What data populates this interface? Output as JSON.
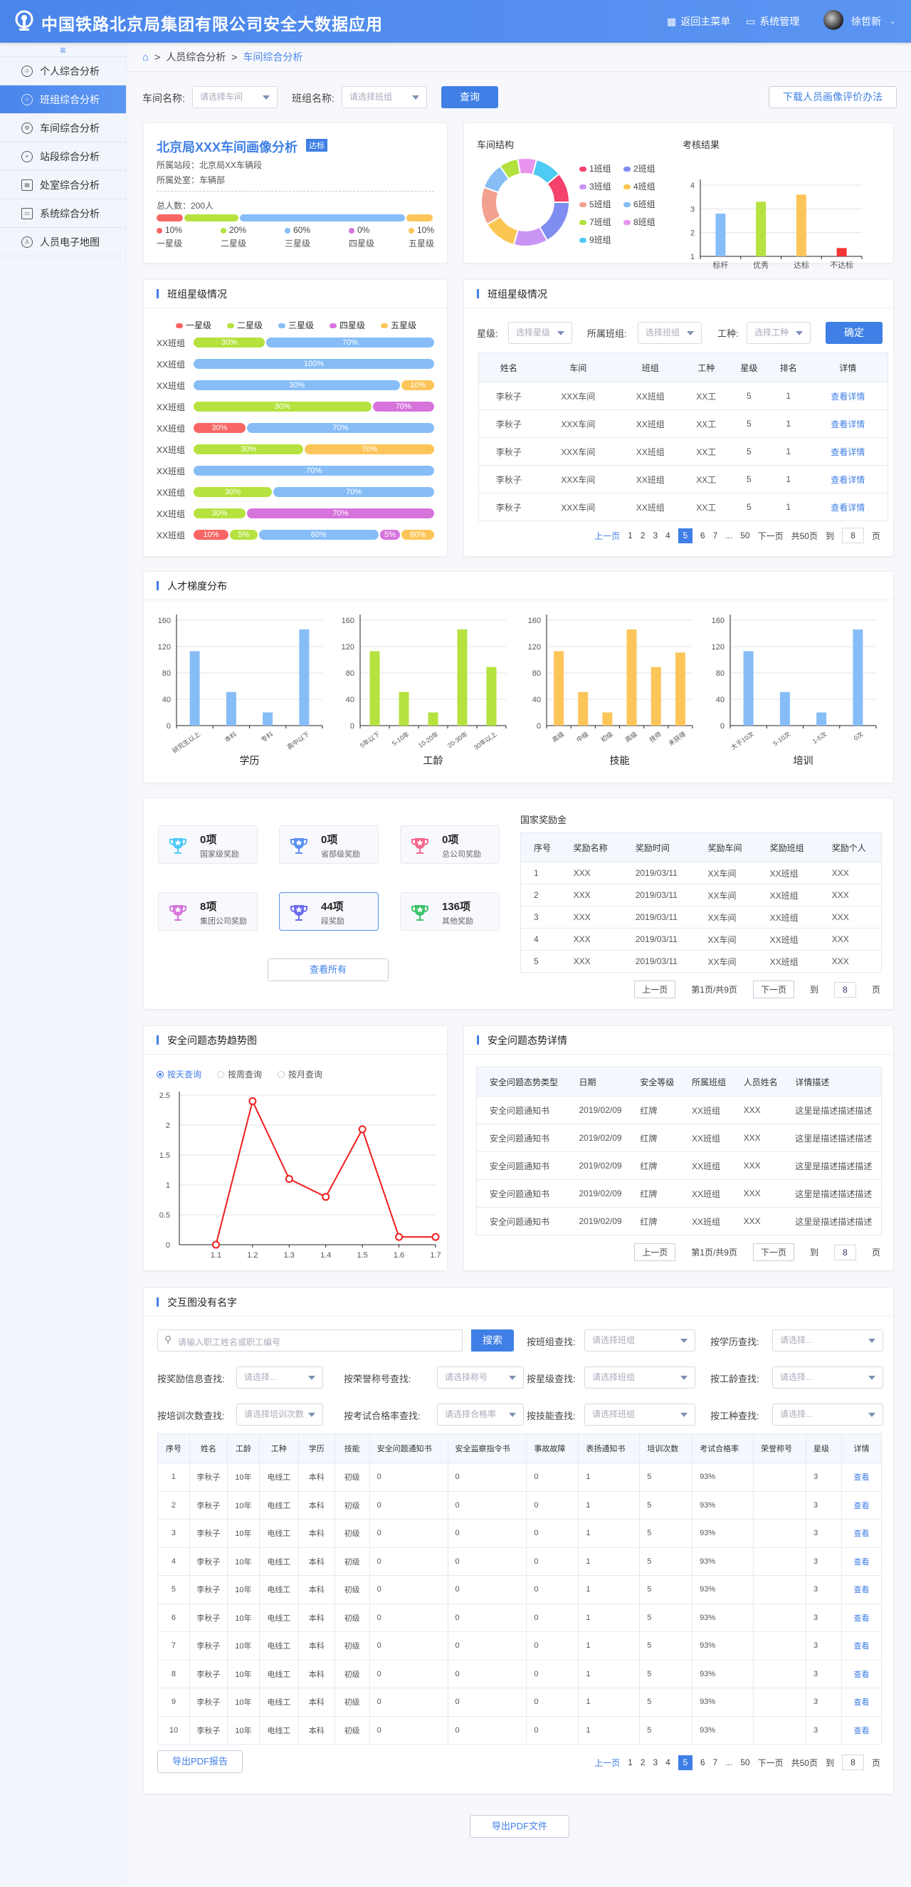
{
  "header": {
    "title": "中国铁路北京局集团有限公司安全大数据应用",
    "back_menu": "返回主菜单",
    "system_mgmt": "系统管理",
    "user": "徐哲新"
  },
  "sidebar": {
    "items": [
      {
        "label": "个人综合分析"
      },
      {
        "label": "班组综合分析"
      },
      {
        "label": "车间综合分析"
      },
      {
        "label": "站段综合分析"
      },
      {
        "label": "处室综合分析"
      },
      {
        "label": "系统综合分析"
      },
      {
        "label": "人员电子地图"
      }
    ]
  },
  "breadcrumb": [
    "人员综合分析",
    "车间综合分析"
  ],
  "filters": {
    "workshop_label": "车间名称:",
    "workshop_ph": "请选择车间",
    "team_label": "班组名称:",
    "team_ph": "请选择班组",
    "query": "查询",
    "download": "下载人员画像评价办法"
  },
  "profile": {
    "title": "北京局XXX车间画像分析",
    "badge": "达标",
    "station": "所属站段：北京局XX车辆段",
    "office": "所属处室：车辆部",
    "total": "总人数：200人",
    "levels": [
      {
        "pct": "10%",
        "name": "一星级",
        "v": 10,
        "color": "#f76565"
      },
      {
        "pct": "20%",
        "name": "二星级",
        "v": 20,
        "color": "#b5e23f"
      },
      {
        "pct": "60%",
        "name": "三星级",
        "v": 60,
        "color": "#86bdf7"
      },
      {
        "pct": "0%",
        "name": "四星级",
        "v": 0,
        "color": "#d674dc"
      },
      {
        "pct": "10%",
        "name": "五星级",
        "v": 10,
        "color": "#fcc55a"
      }
    ]
  },
  "structure": {
    "title": "车间结构",
    "legend": [
      "1班组",
      "2班组",
      "3班组",
      "4班组",
      "5班组",
      "6班组",
      "7班组",
      "8班组",
      "9班组"
    ],
    "values": [
      40,
      60,
      45,
      45,
      50,
      35,
      25,
      25,
      35
    ],
    "colors": [
      "#f5426c",
      "#7f8cf0",
      "#c995f5",
      "#fcc652",
      "#f2a08f",
      "#86bdf5",
      "#b3e13e",
      "#e894ee",
      "#4ecbf5"
    ]
  },
  "chart_data": [
    {
      "type": "bar",
      "title": "考核结果",
      "categories": [
        "标杆",
        "优秀",
        "达标",
        "不达标"
      ],
      "values": [
        2.8,
        3.3,
        3.6,
        1.35
      ],
      "colors": [
        "#86bdf7",
        "#b5e23f",
        "#fcc55a",
        "#f43434"
      ],
      "ylim": [
        1,
        4
      ],
      "yticks": [
        "1",
        "2",
        "3",
        "4"
      ]
    },
    {
      "type": "bar",
      "title": "学历",
      "categories": [
        "研究生以上",
        "本科",
        "专科",
        "高中以下"
      ],
      "values": [
        113,
        51,
        20,
        146
      ],
      "color": "#86bdf7",
      "ylim": [
        0,
        160
      ],
      "yticks": [
        "0",
        "40",
        "80",
        "120",
        "160"
      ]
    },
    {
      "type": "bar",
      "title": "工龄",
      "categories": [
        "5年以下",
        "5-10年",
        "10-20年",
        "20-30年",
        "30年以上"
      ],
      "values": [
        113,
        51,
        20,
        146,
        89
      ],
      "color": "#b5e23f",
      "ylim": [
        0,
        160
      ],
      "yticks": [
        "0",
        "40",
        "80",
        "120",
        "160"
      ]
    },
    {
      "type": "bar",
      "title": "技能",
      "categories": [
        "高级",
        "中级",
        "初级",
        "高级",
        "技师",
        "未获得"
      ],
      "values": [
        113,
        51,
        20,
        146,
        89,
        111
      ],
      "color": "#fcc55a",
      "ylim": [
        0,
        160
      ],
      "yticks": [
        "0",
        "40",
        "80",
        "120",
        "160"
      ]
    },
    {
      "type": "bar",
      "title": "培训",
      "categories": [
        "大于10次",
        "5-10次",
        "1-5次",
        "0次"
      ],
      "values": [
        113,
        51,
        20,
        146
      ],
      "color": "#86bdf7",
      "ylim": [
        0,
        160
      ],
      "yticks": [
        "0",
        "40",
        "80",
        "120",
        "160"
      ]
    },
    {
      "type": "line",
      "title": "安全问题态势趋势图",
      "x": [
        "1.1",
        "1.2",
        "1.3",
        "1.4",
        "1.5",
        "1.6",
        "1.7"
      ],
      "values": [
        0,
        2.4,
        1.1,
        0.8,
        1.93,
        0.13,
        0.13
      ],
      "color": "#f21d1d",
      "ylim": [
        0,
        2.5
      ],
      "yticks": [
        "0",
        "0.5",
        "1",
        "1.5",
        "2",
        "2.5"
      ]
    }
  ],
  "team_star": {
    "title": "班组星级情况",
    "legend": [
      "一星级",
      "二星级",
      "三星级",
      "四星级",
      "五星级"
    ],
    "rows": [
      {
        "label": "XX班组",
        "segs": [
          {
            "l": 1,
            "v": 30,
            "t": "30%"
          },
          {
            "l": 2,
            "v": 70,
            "t": "70%"
          }
        ]
      },
      {
        "label": "XX班组",
        "segs": [
          {
            "l": 2,
            "v": 100,
            "t": "100%"
          }
        ]
      },
      {
        "label": "XX班组",
        "segs": [
          {
            "l": 2,
            "v": 86,
            "t": "30%"
          },
          {
            "l": 4,
            "v": 14,
            "t": "10%"
          }
        ]
      },
      {
        "label": "XX班组",
        "segs": [
          {
            "l": 1,
            "v": 74,
            "t": "30%"
          },
          {
            "l": 3,
            "v": 26,
            "t": "70%"
          }
        ]
      },
      {
        "label": "XX班组",
        "segs": [
          {
            "l": 0,
            "v": 22,
            "t": "30%"
          },
          {
            "l": 2,
            "v": 78,
            "t": "70%"
          }
        ]
      },
      {
        "label": "XX班组",
        "segs": [
          {
            "l": 1,
            "v": 46,
            "t": "30%"
          },
          {
            "l": 4,
            "v": 54,
            "t": "70%"
          }
        ]
      },
      {
        "label": "XX班组",
        "segs": [
          {
            "l": 2,
            "v": 100,
            "t": "70%"
          }
        ]
      },
      {
        "label": "XX班组",
        "segs": [
          {
            "l": 1,
            "v": 33,
            "t": "30%"
          },
          {
            "l": 2,
            "v": 67,
            "t": "70%"
          }
        ]
      },
      {
        "label": "XX班组",
        "segs": [
          {
            "l": 1,
            "v": 22,
            "t": "30%"
          },
          {
            "l": 3,
            "v": 78,
            "t": "70%"
          }
        ]
      },
      {
        "label": "XX班组",
        "segs": [
          {
            "l": 0,
            "v": 15,
            "t": "10%"
          },
          {
            "l": 1,
            "v": 12,
            "t": "5%"
          },
          {
            "l": 2,
            "v": 50,
            "t": "60%"
          },
          {
            "l": 3,
            "v": 9,
            "t": "5%"
          },
          {
            "l": 4,
            "v": 14,
            "t": "60%"
          }
        ]
      }
    ]
  },
  "team_table": {
    "title": "班组星级情况",
    "star_label": "星级:",
    "star_ph": "选择星级",
    "team_label": "所属班组:",
    "team_ph": "选择班组",
    "type_label": "工种:",
    "type_ph": "选择工种",
    "confirm": "确定",
    "columns": [
      "姓名",
      "车间",
      "班组",
      "工种",
      "星级",
      "排名",
      "详情"
    ],
    "rows": [
      [
        "李秋子",
        "XXX车间",
        "XX班组",
        "XX工",
        "5",
        "1",
        "查看详情"
      ],
      [
        "李秋子",
        "XXX车间",
        "XX班组",
        "XX工",
        "5",
        "1",
        "查看详情"
      ],
      [
        "李秋子",
        "XXX车间",
        "XX班组",
        "XX工",
        "5",
        "1",
        "查看详情"
      ],
      [
        "李秋子",
        "XXX车间",
        "XX班组",
        "XX工",
        "5",
        "1",
        "查看详情"
      ],
      [
        "李秋子",
        "XXX车间",
        "XX班组",
        "XX工",
        "5",
        "1",
        "查看详情"
      ]
    ]
  },
  "pager": {
    "prev": "上一页",
    "pages": [
      "1",
      "2",
      "3",
      "4",
      "5",
      "6",
      "7",
      "...",
      "50"
    ],
    "current": "5",
    "next": "下一页",
    "total": "共50页",
    "goto": "到",
    "goto_val": "8",
    "page": "页"
  },
  "talent": {
    "title": "人才梯度分布"
  },
  "awards": {
    "items": [
      {
        "num": "0项",
        "name": "国家级奖励",
        "color": "#4fc8f7"
      },
      {
        "num": "0项",
        "name": "省部级奖励",
        "color": "#5b8ff0"
      },
      {
        "num": "0项",
        "name": "总公司奖励",
        "color": "#f5668c"
      },
      {
        "num": "8项",
        "name": "集团公司奖励",
        "color": "#d674dc"
      },
      {
        "num": "44项",
        "name": "段奖励",
        "color": "#6b6cf0"
      },
      {
        "num": "136项",
        "name": "其他奖励",
        "color": "#3ec26a"
      }
    ],
    "view_all": "查看所有",
    "table_title": "国家奖励金",
    "columns": [
      "序号",
      "奖励名称",
      "奖励时间",
      "奖励车间",
      "奖励班组",
      "奖励个人"
    ],
    "rows": [
      [
        "1",
        "XXX",
        "2019/03/11",
        "XX车间",
        "XX班组",
        "XXX"
      ],
      [
        "2",
        "XXX",
        "2019/03/11",
        "XX车间",
        "XX班组",
        "XXX"
      ],
      [
        "3",
        "XXX",
        "2019/03/11",
        "XX车间",
        "XX班组",
        "XXX"
      ],
      [
        "4",
        "XXX",
        "2019/03/11",
        "XX车间",
        "XX班组",
        "XXX"
      ],
      [
        "5",
        "XXX",
        "2019/03/11",
        "XX车间",
        "XX班组",
        "XXX"
      ]
    ]
  },
  "simple_pager": {
    "prev": "上一页",
    "info": "第1页/共9页",
    "next": "下一页",
    "goto": "到",
    "goto_val": "8",
    "page": "页"
  },
  "trend": {
    "title": "安全问题态势趋势图",
    "radios": [
      "按天查询",
      "按周查询",
      "按月查询"
    ]
  },
  "safety": {
    "title": "安全问题态势详情",
    "columns": [
      "安全问题态势类型",
      "日期",
      "安全等级",
      "所属班组",
      "人员姓名",
      "详情描述"
    ],
    "rows": [
      [
        "安全问题通知书",
        "2019/02/09",
        "红牌",
        "XX班组",
        "XXX",
        "这里是描述描述描述"
      ],
      [
        "安全问题通知书",
        "2019/02/09",
        "红牌",
        "XX班组",
        "XXX",
        "这里是描述描述描述"
      ],
      [
        "安全问题通知书",
        "2019/02/09",
        "红牌",
        "XX班组",
        "XXX",
        "这里是描述描述描述"
      ],
      [
        "安全问题通知书",
        "2019/02/09",
        "红牌",
        "XX班组",
        "XXX",
        "这里是描述描述描述"
      ],
      [
        "安全问题通知书",
        "2019/02/09",
        "红牌",
        "XX班组",
        "XXX",
        "这里是描述描述描述"
      ]
    ]
  },
  "interactive": {
    "title": "交互图没有名字",
    "search_ph": "请输入职工姓名或职工编号",
    "search": "搜索",
    "filters": [
      {
        "label": "按班组查找:",
        "ph": "请选择班组"
      },
      {
        "label": "按学历查找:",
        "ph": "请选择..."
      },
      {
        "label": "按奖励信息查找:",
        "ph": "请选择..."
      },
      {
        "label": "按荣誉称号查找:",
        "ph": "请选择称号"
      },
      {
        "label": "按星级查找:",
        "ph": "请选择班组"
      },
      {
        "label": "按工龄查找:",
        "ph": "请选择..."
      },
      {
        "label": "按培训次数查找:",
        "ph": "请选择培训次数"
      },
      {
        "label": "按考试合格率查找:",
        "ph": "请选择合格率"
      },
      {
        "label": "按技能查找:",
        "ph": "请选择班组"
      },
      {
        "label": "按工种查找:",
        "ph": "请选择..."
      }
    ],
    "columns": [
      "序号",
      "姓名",
      "工龄",
      "工种",
      "学历",
      "技能",
      "安全问题通知书",
      "安全监察指令书",
      "事故故障",
      "表扬通知书",
      "培训次数",
      "考试合格率",
      "荣誉称号",
      "星级",
      "详情"
    ],
    "rows": [
      [
        "1",
        "李秋子",
        "10年",
        "电线工",
        "本科",
        "初级",
        "0",
        "0",
        "0",
        "1",
        "5",
        "93%",
        "",
        "3",
        "查看"
      ],
      [
        "2",
        "李秋子",
        "10年",
        "电线工",
        "本科",
        "初级",
        "0",
        "0",
        "0",
        "1",
        "5",
        "93%",
        "",
        "3",
        "查看"
      ],
      [
        "3",
        "李秋子",
        "10年",
        "电线工",
        "本科",
        "初级",
        "0",
        "0",
        "0",
        "1",
        "5",
        "93%",
        "",
        "3",
        "查看"
      ],
      [
        "4",
        "李秋子",
        "10年",
        "电线工",
        "本科",
        "初级",
        "0",
        "0",
        "0",
        "1",
        "5",
        "93%",
        "",
        "3",
        "查看"
      ],
      [
        "5",
        "李秋子",
        "10年",
        "电线工",
        "本科",
        "初级",
        "0",
        "0",
        "0",
        "1",
        "5",
        "93%",
        "",
        "3",
        "查看"
      ],
      [
        "6",
        "李秋子",
        "10年",
        "电线工",
        "本科",
        "初级",
        "0",
        "0",
        "0",
        "1",
        "5",
        "93%",
        "",
        "3",
        "查看"
      ],
      [
        "7",
        "李秋子",
        "10年",
        "电线工",
        "本科",
        "初级",
        "0",
        "0",
        "0",
        "1",
        "5",
        "93%",
        "",
        "3",
        "查看"
      ],
      [
        "8",
        "李秋子",
        "10年",
        "电线工",
        "本科",
        "初级",
        "0",
        "0",
        "0",
        "1",
        "5",
        "93%",
        "",
        "3",
        "查看"
      ],
      [
        "9",
        "李秋子",
        "10年",
        "电线工",
        "本科",
        "初级",
        "0",
        "0",
        "0",
        "1",
        "5",
        "93%",
        "",
        "3",
        "查看"
      ],
      [
        "10",
        "李秋子",
        "10年",
        "电线工",
        "本科",
        "初级",
        "0",
        "0",
        "0",
        "1",
        "5",
        "93%",
        "",
        "3",
        "查看"
      ]
    ],
    "export_report": "导出PDF报告"
  },
  "export_file": "导出PDF文件"
}
